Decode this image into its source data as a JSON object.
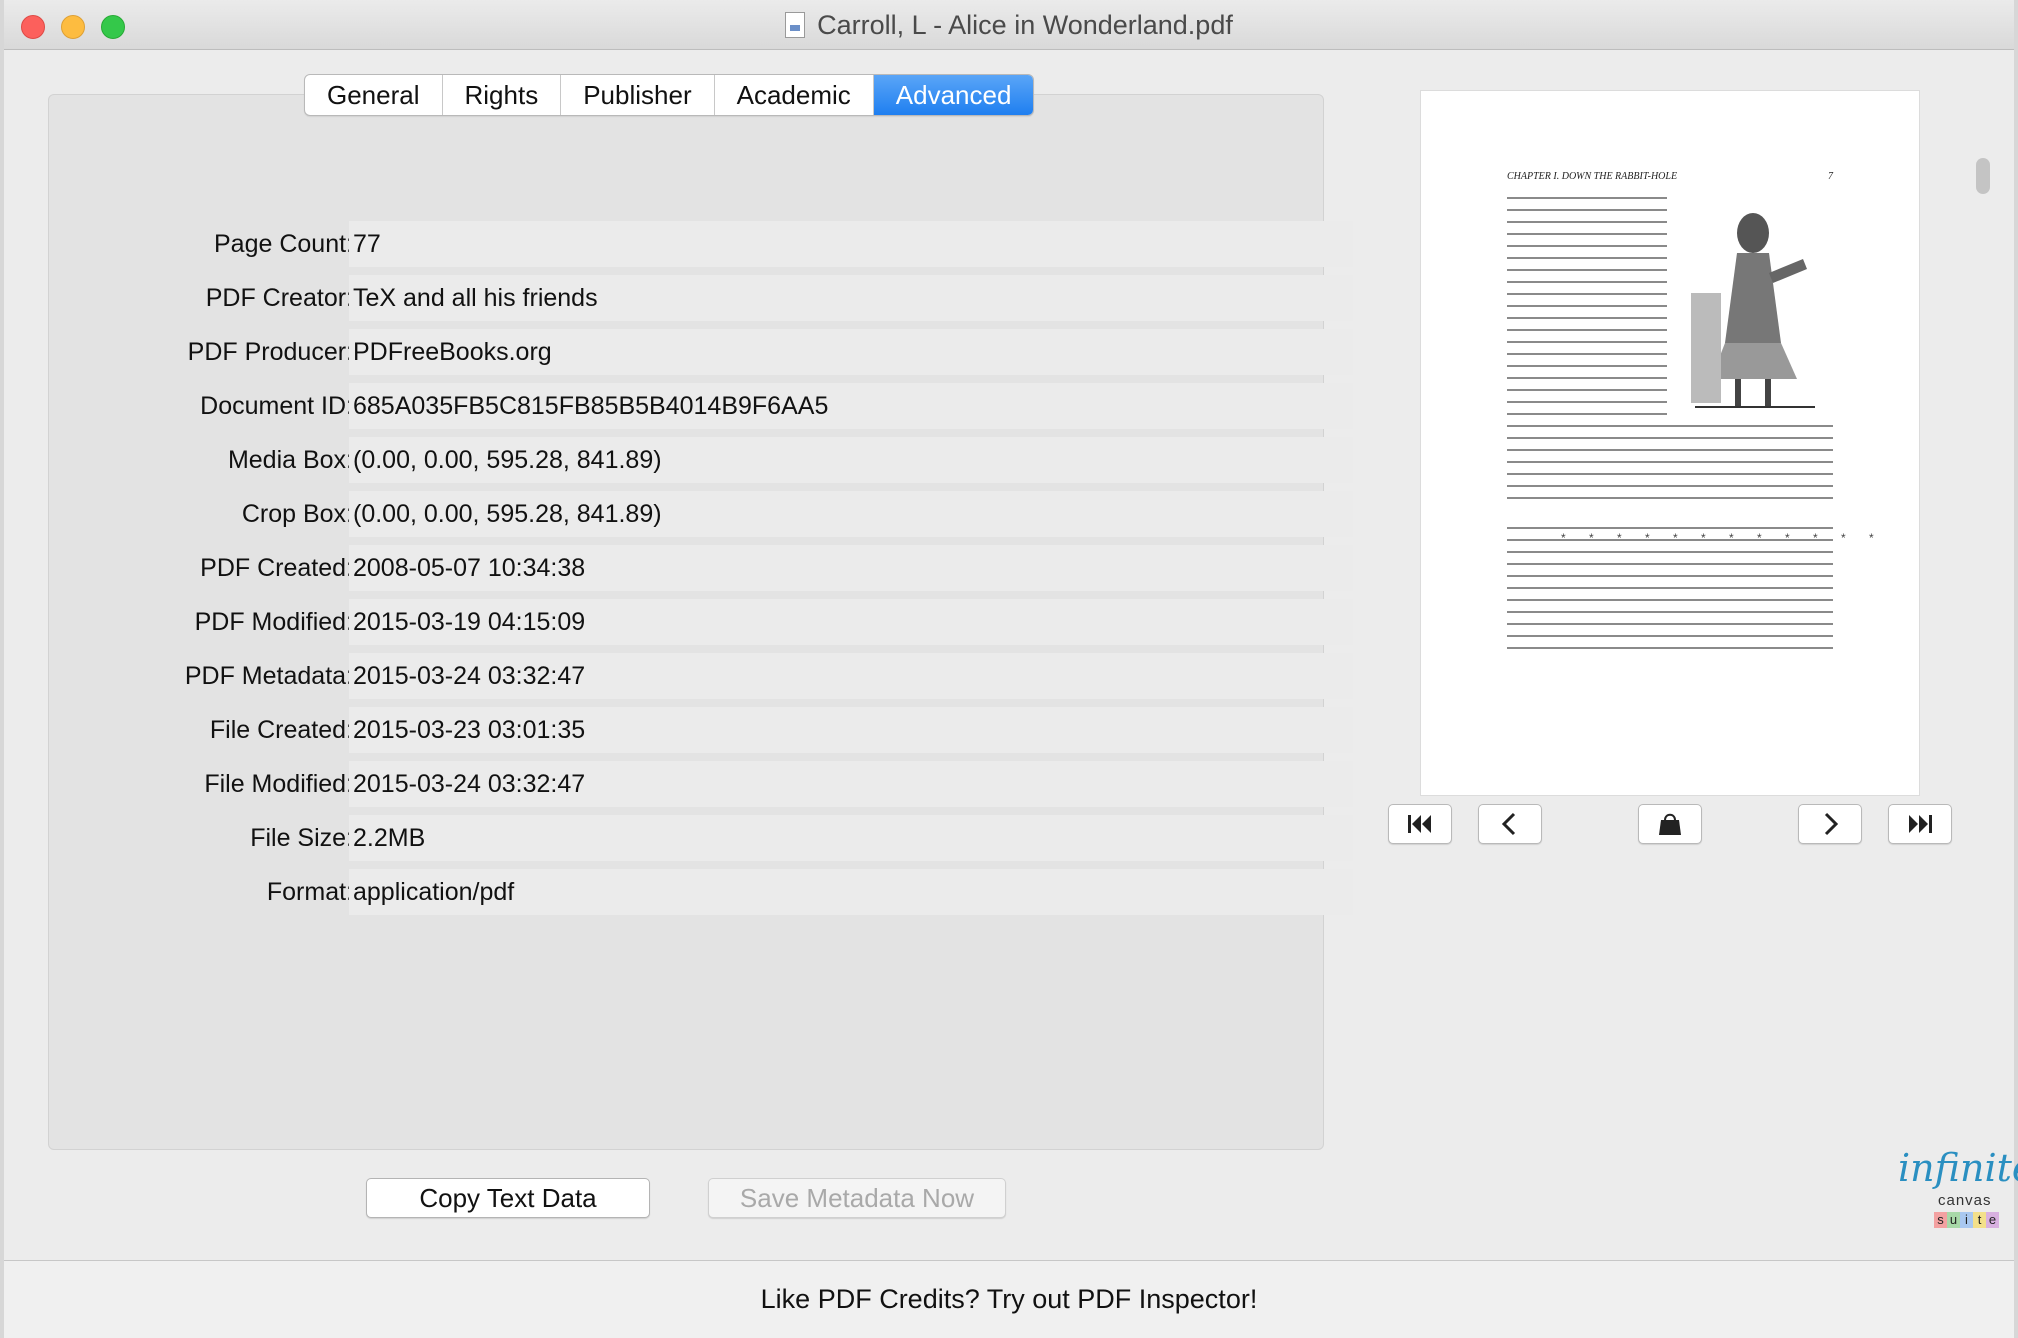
{
  "window": {
    "title": "Carroll, L - Alice in Wonderland.pdf"
  },
  "tabs": [
    {
      "label": "General",
      "active": false
    },
    {
      "label": "Rights",
      "active": false
    },
    {
      "label": "Publisher",
      "active": false
    },
    {
      "label": "Academic",
      "active": false
    },
    {
      "label": "Advanced",
      "active": true
    }
  ],
  "metadata": [
    {
      "label": "Page Count:",
      "value": "77"
    },
    {
      "label": "PDF Creator:",
      "value": "TeX and all his friends"
    },
    {
      "label": "PDF Producer:",
      "value": "PDFreeBooks.org"
    },
    {
      "label": "Document ID:",
      "value": "685A035FB5C815FB85B5B4014B9F6AA5"
    },
    {
      "label": "Media Box:",
      "value": "(0.00, 0.00, 595.28, 841.89)"
    },
    {
      "label": "Crop Box:",
      "value": "(0.00, 0.00, 595.28, 841.89)"
    },
    {
      "label": "PDF Created:",
      "value": "2008-05-07 10:34:38"
    },
    {
      "label": "PDF Modified:",
      "value": "2015-03-19 04:15:09"
    },
    {
      "label": "PDF Metadata:",
      "value": "2015-03-24 03:32:47"
    },
    {
      "label": "File Created:",
      "value": "2015-03-23 03:01:35"
    },
    {
      "label": "File Modified:",
      "value": "2015-03-24 03:32:47"
    },
    {
      "label": "File Size:",
      "value": "2.2MB"
    },
    {
      "label": "Format:",
      "value": "application/pdf"
    }
  ],
  "buttons": {
    "copy": "Copy Text Data",
    "save": "Save Metadata Now"
  },
  "preview": {
    "header_left": "CHAPTER I.  DOWN THE RABBIT-HOLE",
    "header_right": "7"
  },
  "logo": {
    "script": "infinite",
    "line2": "canvas",
    "suite": [
      "s",
      "u",
      "i",
      "t",
      "e"
    ],
    "suite_colors": [
      "#f3a1a1",
      "#a8d8a8",
      "#a9c8f0",
      "#f3e08a",
      "#d8b0e0"
    ]
  },
  "footer": {
    "text": "Like PDF Credits? Try out PDF Inspector!"
  },
  "icons": [
    "first-page-icon",
    "prev-page-icon",
    "shop-bag-icon",
    "next-page-icon",
    "last-page-icon"
  ]
}
